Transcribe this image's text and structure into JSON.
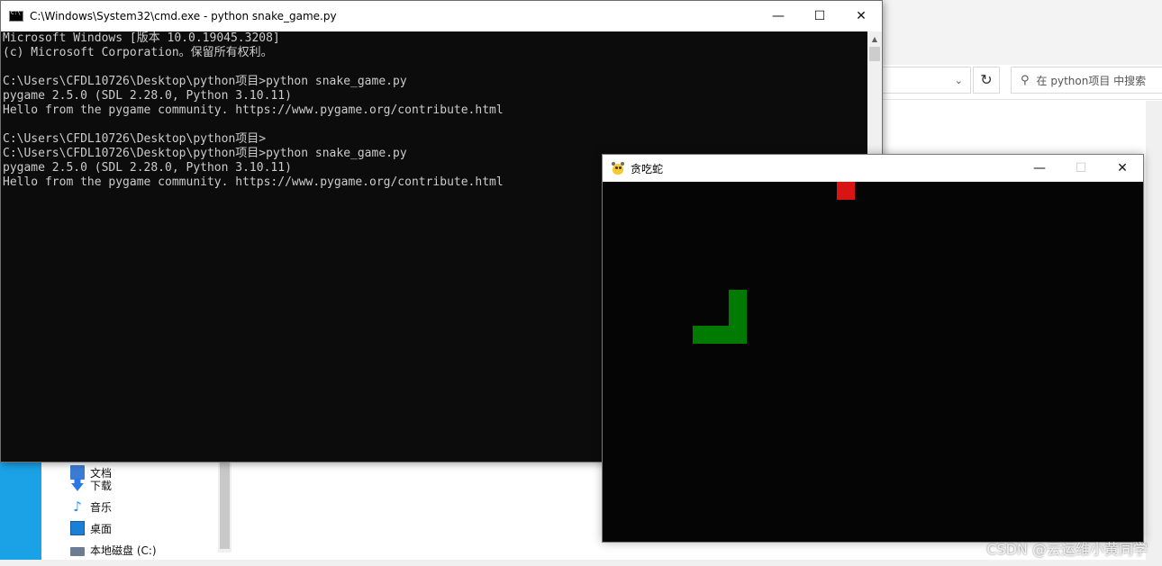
{
  "explorer": {
    "search_placeholder": "在 python项目 中搜索",
    "refresh_glyph": "↻",
    "dropdown_glyph": "⌄",
    "nav_items": [
      {
        "label": "文档",
        "icon": "document-icon"
      },
      {
        "label": "下载",
        "icon": "download-icon"
      },
      {
        "label": "音乐",
        "icon": "music-icon"
      },
      {
        "label": "桌面",
        "icon": "desktop-icon"
      },
      {
        "label": "本地磁盘 (C:)",
        "icon": "disk-icon"
      }
    ],
    "accent_color": "#1aa1e6"
  },
  "cmd": {
    "title": "C:\\Windows\\System32\\cmd.exe - python  snake_game.py",
    "buttons": {
      "minimize": "—",
      "maximize": "☐",
      "close": "✕"
    },
    "lines": [
      "Microsoft Windows [版本 10.0.19045.3208]",
      "(c) Microsoft Corporation。保留所有权利。",
      "",
      "C:\\Users\\CFDL10726\\Desktop\\python项目>python snake_game.py",
      "pygame 2.5.0 (SDL 2.28.0, Python 3.10.11)",
      "Hello from the pygame community. https://www.pygame.org/contribute.html",
      "",
      "C:\\Users\\CFDL10726\\Desktop\\python项目>",
      "C:\\Users\\CFDL10726\\Desktop\\python项目>python snake_game.py",
      "pygame 2.5.0 (SDL 2.28.0, Python 3.10.11)",
      "Hello from the pygame community. https://www.pygame.org/contribute.html"
    ],
    "background_color": "#0c0c0c",
    "text_color": "#cccccc"
  },
  "game": {
    "title": "贪吃蛇",
    "buttons": {
      "minimize": "—",
      "maximize": "☐",
      "close": "✕"
    },
    "grid_columns": 30,
    "grid_rows": 20,
    "snake_cells": [
      [
        5,
        8
      ],
      [
        6,
        8
      ],
      [
        7,
        8
      ],
      [
        7,
        7
      ],
      [
        7,
        6
      ]
    ],
    "food_cell": [
      13,
      0
    ],
    "snake_color": "#007a00",
    "food_color": "#d81414",
    "background_color": "#050505"
  },
  "watermark": "CSDN @云运维小黄同学"
}
